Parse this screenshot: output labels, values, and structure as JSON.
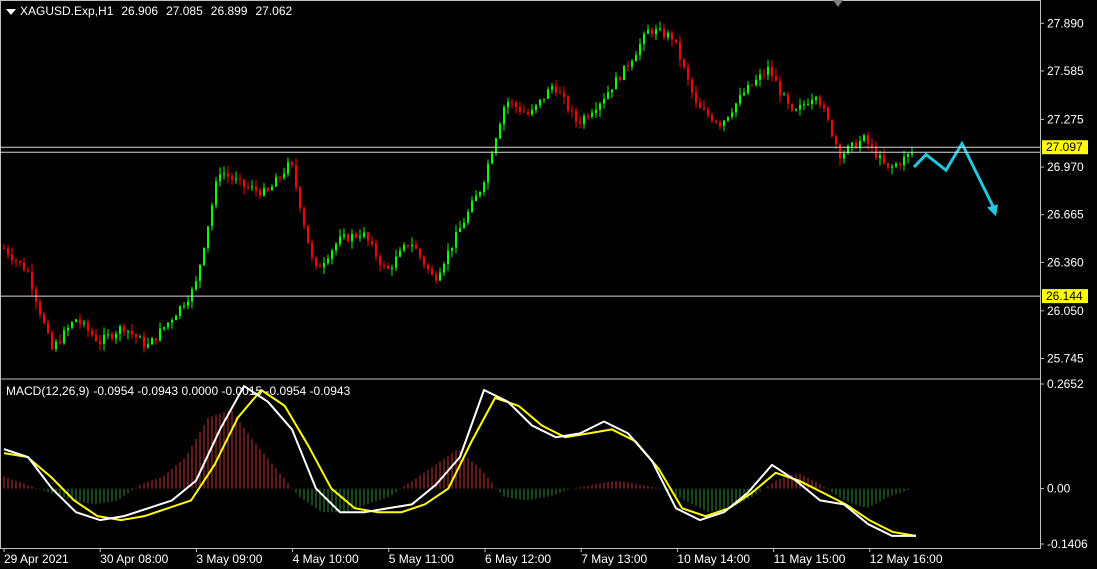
{
  "header": {
    "symbol": "XAGUSD.Exp,H1",
    "open": "26.906",
    "high": "27.085",
    "low": "26.899",
    "close": "27.062"
  },
  "macd_header": {
    "name": "MACD(12,26,9)",
    "values": "-0.0954 -0.0943 0.0000 -0.0015 -0.0954 -0.0943"
  },
  "colors": {
    "bull": "#00ff00",
    "bear": "#ff0000",
    "signal": "#ffff00",
    "macd": "#ffffff",
    "forecast": "#1fc8e0",
    "highlight": "#ffff00"
  },
  "chart_data": [
    {
      "type": "candlestick",
      "price_axis": [
        "27.890",
        "27.585",
        "27.275",
        "26.970",
        "26.665",
        "26.360",
        "26.050",
        "25.745"
      ],
      "ylim": [
        25.62,
        28.02
      ],
      "time_axis": [
        "29 Apr 2021",
        "30 Apr 08:00",
        "3 May 09:00",
        "4 May 10:00",
        "5 May 11:00",
        "6 May 12:00",
        "7 May 13:00",
        "10 May 14:00",
        "11 May 15:00",
        "12 May 16:00"
      ],
      "levels": [
        {
          "label": "27.097",
          "value": 27.097,
          "highlight": true
        },
        {
          "value": 27.065
        },
        {
          "label": "26.144",
          "value": 26.144,
          "highlight": true
        }
      ],
      "trend_path": [
        26.45,
        26.3,
        25.8,
        26.0,
        25.85,
        25.95,
        25.82,
        26.0,
        26.2,
        26.95,
        26.85,
        26.8,
        27.0,
        26.3,
        26.5,
        26.55,
        26.3,
        26.5,
        26.25,
        26.55,
        26.85,
        27.4,
        27.3,
        27.5,
        27.25,
        27.4,
        27.6,
        27.85,
        27.8,
        27.35,
        27.25,
        27.45,
        27.6,
        27.3,
        27.45,
        27.05,
        27.15,
        26.95,
        27.06
      ],
      "forecast_arrow": [
        26.97,
        27.05,
        26.95,
        27.12,
        26.68
      ]
    },
    {
      "type": "macd",
      "axis": [
        "0.2652",
        "0.00",
        "-0.1406"
      ],
      "ylim": [
        -0.1406,
        0.2652
      ],
      "histogram": [
        0.03,
        0.01,
        -0.01,
        -0.03,
        -0.04,
        -0.03,
        0.01,
        0.03,
        0.08,
        0.18,
        0.2,
        0.12,
        0.05,
        -0.02,
        -0.06,
        -0.06,
        -0.04,
        -0.02,
        0.02,
        0.06,
        0.1,
        0.05,
        -0.02,
        -0.03,
        -0.02,
        0.0,
        0.01,
        0.02,
        0.01,
        0.0,
        -0.03,
        -0.06,
        -0.05,
        -0.02,
        0.02,
        0.04,
        0.01,
        -0.03,
        -0.05,
        -0.02,
        0.0
      ],
      "macd_line": [
        0.1,
        0.08,
        0.0,
        -0.06,
        -0.08,
        -0.07,
        -0.05,
        -0.03,
        0.02,
        0.15,
        0.26,
        0.22,
        0.15,
        0.0,
        -0.06,
        -0.06,
        -0.05,
        -0.04,
        0.01,
        0.08,
        0.25,
        0.22,
        0.16,
        0.13,
        0.14,
        0.17,
        0.14,
        0.07,
        -0.05,
        -0.08,
        -0.06,
        -0.01,
        0.06,
        0.02,
        -0.03,
        -0.04,
        -0.09,
        -0.12,
        -0.12
      ],
      "signal_line": [
        0.09,
        0.08,
        0.03,
        -0.03,
        -0.07,
        -0.08,
        -0.07,
        -0.05,
        -0.03,
        0.06,
        0.18,
        0.25,
        0.21,
        0.11,
        0.0,
        -0.05,
        -0.06,
        -0.06,
        -0.04,
        0.0,
        0.12,
        0.23,
        0.21,
        0.16,
        0.13,
        0.14,
        0.15,
        0.12,
        0.05,
        -0.05,
        -0.07,
        -0.05,
        -0.01,
        0.04,
        0.02,
        -0.01,
        -0.04,
        -0.08,
        -0.11,
        -0.12
      ]
    }
  ]
}
